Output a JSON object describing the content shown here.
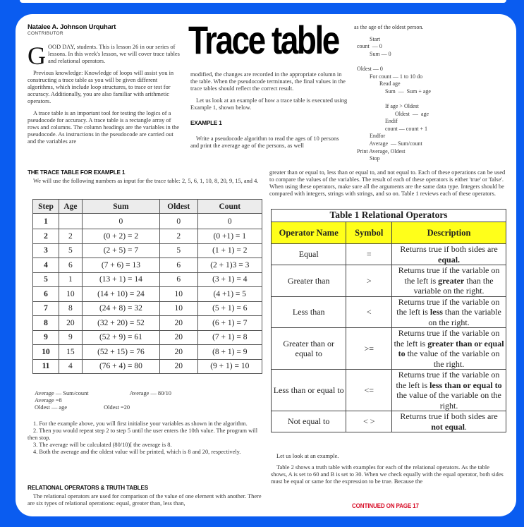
{
  "frame": {
    "color": "#0a5cf0"
  },
  "byline": {
    "author": "Natalee A. Johnson Urquhart",
    "role": "CONTRIBUTOR"
  },
  "title": "Trace table",
  "intro": {
    "dropcap": "G",
    "p1": "OOD DAY, students. This is lesson 26 in our series of lessons. In this week's lesson, we will cover trace tables and relational operators.",
    "p2": "Previous knowledge: Knowledge of loops will assist you in constructing a trace table as you will be given different algorithms, which include loop structures, to trace or test for accuracy.  Additionally, you are also familiar with arithmetic operators.",
    "p3": "A trace table is an important tool for testing the logics of a pseudocode for accuracy.  A trace table is a rectangle array of rows and columns.  The column headings are the variables in the pseudocode.  As instructions in the pseudocode are carried out and the variables are"
  },
  "col2": {
    "p1": "modified, the changes are recorded in the appropriate column in the table.  When the pseudocode terminates, the final values in the trace tables should reflect the correct result.",
    "p2": "Let us look at an example of how a trace table is executed using Example 1, shown below.",
    "example_heading": "EXAMPLE 1",
    "p3": "Write a pseudocode algorithm to read the ages of 10 persons and print the average age of the persons, as well"
  },
  "pseudocode": {
    "lead": "as the age of the oldest person.",
    "lines": [
      "           Start",
      "  count  — 0",
      "           Sum — 0",
      "",
      "  Oldest — 0",
      "           For count — 1 to 10 do",
      "                  Read age",
      "                      Sum  —  Sum + age",
      "",
      "                      If age > Oldest",
      "                             Oldest  —  age",
      "                      Endif",
      "                      count — count + 1",
      "           Endfor",
      "           Average  — Sum/count",
      "  Print Average, Oldest",
      "           Stop"
    ]
  },
  "trace_section": {
    "heading": "THE TRACE TABLE FOR EXAMPLE 1",
    "intro": "We will use the following numbers as input for the trace table: 2, 5, 6, 1, 10, 8, 20, 9, 15, and 4.",
    "columns": [
      "Step",
      "Age",
      "Sum",
      "Oldest",
      "Count"
    ],
    "rows": [
      [
        "1",
        "",
        "0",
        "0",
        "0"
      ],
      [
        "2",
        "2",
        "(0 + 2) = 2",
        "2",
        "(0 +1) = 1"
      ],
      [
        "3",
        "5",
        "(2 + 5) = 7",
        "5",
        "(1 + 1) = 2"
      ],
      [
        "4",
        "6",
        "(7 + 6) = 13",
        "6",
        "(2 + 1)3 = 3"
      ],
      [
        "5",
        "1",
        "(13 + 1) = 14",
        "6",
        "(3 + 1) = 4"
      ],
      [
        "6",
        "10",
        "(14 + 10) = 24",
        "10",
        "(4 +1) = 5"
      ],
      [
        "7",
        "8",
        "(24 + 8) = 32",
        "10",
        "(5 + 1) = 6"
      ],
      [
        "8",
        "20",
        "(32 + 20) = 52",
        "20",
        "(6 + 1) = 7"
      ],
      [
        "9",
        "9",
        "(52 + 9) = 61",
        "20",
        "(7 + 1) = 8"
      ],
      [
        "10",
        "15",
        "(52 + 15) = 76",
        "20",
        "(8 + 1) = 9"
      ],
      [
        "11",
        "4",
        "(76 + 4) = 80",
        "20",
        "(9 + 1) = 10"
      ]
    ],
    "calc": {
      "line1a": "Average — Sum/count",
      "line1b": "Average  — 80/10",
      "line2": "Average =8",
      "line3a": "Oldest  — age",
      "line3b": "Oldest =20"
    },
    "steps": [
      "1. For the example above, you will first initialise your variables as shown in the algorithm.",
      "2. Then you would repeat step 2 to step 5 until the user enters the 10th value.  The program will then stop.",
      "3. The average will be calculated (80/10)[ the average is 8.",
      "4. Both the average and the oldest value will be printed, which is 8 and 20, respectively."
    ]
  },
  "relational": {
    "heading": "RELATIONAL OPERATORS  & TRUTH TABLES",
    "p1": "The relational operators are used for comparison of the value of one element with another. There are six types of relational operations: equal, greater than, less than,",
    "p2": "greater than or equal to, less than or equal to, and not equal to. Each of these operations can be used to compare the values of the variables. The result of each of these operators is either 'true' or 'false'. When using these operators, make sure all the arguments are the same data type. Integers should be compared with integers, strings with strings, and so on. Table 1 reviews each of these operators."
  },
  "ops_table": {
    "caption": "Table 1 Relational Operators",
    "header_color": "#ffff1a",
    "columns": [
      "Operator Name",
      "Symbol",
      "Description"
    ],
    "rows": [
      {
        "name": "Equal",
        "symbol": "=",
        "pre": "Returns true if both sides are ",
        "bold": "equal.",
        "post": ""
      },
      {
        "name": "Greater than",
        "symbol": ">",
        "pre": "Returns true if the variable on the left is ",
        "bold": "greater",
        "post": " than the variable on the right."
      },
      {
        "name": "Less than",
        "symbol": "<",
        "pre": "Returns true if the variable on the left is ",
        "bold": "less",
        "post": " than the variable on the right."
      },
      {
        "name": "Greater than or equal to",
        "symbol": ">=",
        "pre": "Returns true if the variable on the left is ",
        "bold": "greater than or equal to",
        "post": " the value of the variable on the right."
      },
      {
        "name": "Less than or equal to",
        "symbol": "<=",
        "pre": "Returns true if the variable on the left is ",
        "bold": "less than or equal to",
        "post": " the value of the variable on the right."
      },
      {
        "name": "Not equal to",
        "symbol": "< >",
        "pre": "Returns true if both sides are ",
        "bold": "not equal",
        "post": "."
      }
    ]
  },
  "after_table": {
    "p1": "Let us look at an example.",
    "p2": "Table 2 shows a truth table with examples for each of the relational operators. As the table shows, A is set to 60 and B is set to 30. When we check equally with the equal operator, both sides must be equal or same for the expression to be true. Because the"
  },
  "continued": "CONTINUED ON PAGE 17"
}
